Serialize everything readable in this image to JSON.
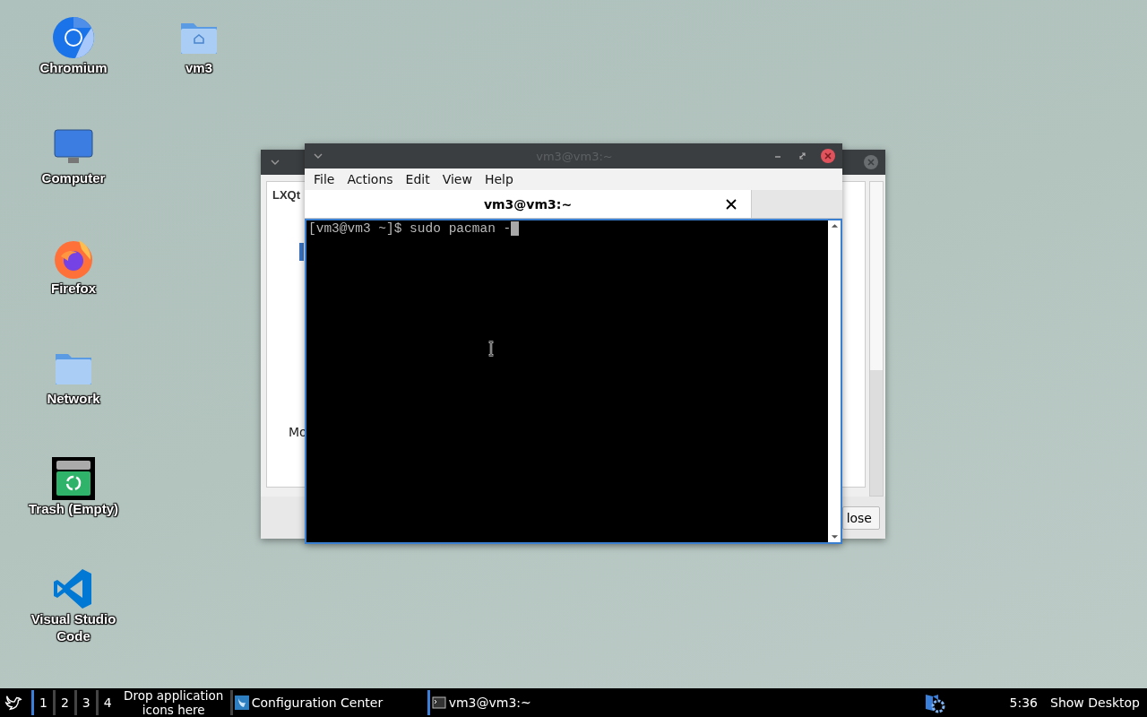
{
  "desktop_icons": [
    {
      "label": "Chromium",
      "kind": "chromium"
    },
    {
      "label": "Computer",
      "kind": "monitor"
    },
    {
      "label": "Firefox",
      "kind": "firefox"
    },
    {
      "label": "Network",
      "kind": "folder"
    },
    {
      "label": "Trash (Empty)",
      "kind": "trash"
    },
    {
      "label": "Visual Studio Code",
      "kind": "vscode"
    },
    {
      "label": "vm3",
      "kind": "home-folder"
    }
  ],
  "back_window": {
    "heading": "LXQt",
    "label_2": "Mo",
    "button": "lose"
  },
  "terminal": {
    "title": "vm3@vm3:~",
    "menu": [
      "File",
      "Actions",
      "Edit",
      "View",
      "Help"
    ],
    "tabs": [
      {
        "label": "vm3@vm3:~",
        "selected": true
      }
    ],
    "lines": [
      "[vm3@vm3 ~]$ sudo pacman -"
    ]
  },
  "taskbar": {
    "desktops": [
      {
        "label": "1",
        "selected": true
      },
      {
        "label": "2",
        "selected": false
      },
      {
        "label": "3",
        "selected": false
      },
      {
        "label": "4",
        "selected": false
      }
    ],
    "quicklaunch_hint": "Drop application icons here",
    "tasks": [
      {
        "label": "Configuration Center",
        "kind": "config",
        "active": false
      },
      {
        "label": "vm3@vm3:~",
        "kind": "terminal",
        "active": true
      }
    ],
    "clock": "5:36",
    "show_desktop": "Show Desktop"
  }
}
